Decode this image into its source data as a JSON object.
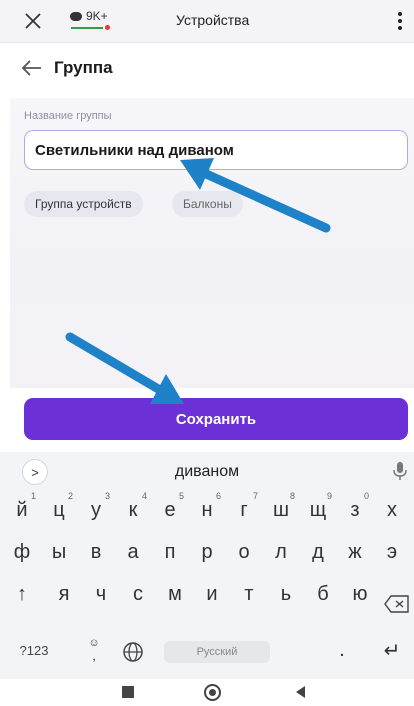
{
  "browser": {
    "badge_text": "9K+",
    "title": "Устройства"
  },
  "header": {
    "title": "Группа"
  },
  "form": {
    "name_label": "Название группы",
    "name_value": "Светильники над диваном",
    "chips": [
      "Группа устройств",
      "Балконы"
    ]
  },
  "save_button": "Сохранить",
  "keyboard": {
    "suggestion": "диваном",
    "row1": [
      {
        "ch": "й",
        "hint": "1"
      },
      {
        "ch": "ц",
        "hint": "2"
      },
      {
        "ch": "у",
        "hint": "3"
      },
      {
        "ch": "к",
        "hint": "4"
      },
      {
        "ch": "е",
        "hint": "5"
      },
      {
        "ch": "н",
        "hint": "6"
      },
      {
        "ch": "г",
        "hint": "7"
      },
      {
        "ch": "ш",
        "hint": "8"
      },
      {
        "ch": "щ",
        "hint": "9"
      },
      {
        "ch": "з",
        "hint": "0"
      },
      {
        "ch": "х",
        "hint": ""
      }
    ],
    "row2": [
      "ф",
      "ы",
      "в",
      "а",
      "п",
      "р",
      "о",
      "л",
      "д",
      "ж",
      "э"
    ],
    "row3": [
      "я",
      "ч",
      "с",
      "м",
      "и",
      "т",
      "ь",
      "б",
      "ю"
    ],
    "symbols_key": "?123",
    "comma": ",",
    "emoji_hint": "☺",
    "space_label": "Русский",
    "period": ".",
    "shift": "↑",
    "enter": "↵"
  },
  "colors": {
    "accent": "#6b31d6",
    "input_border": "#b7a6df",
    "arrow": "#1f82c9",
    "badge_green": "#2e9e49"
  }
}
